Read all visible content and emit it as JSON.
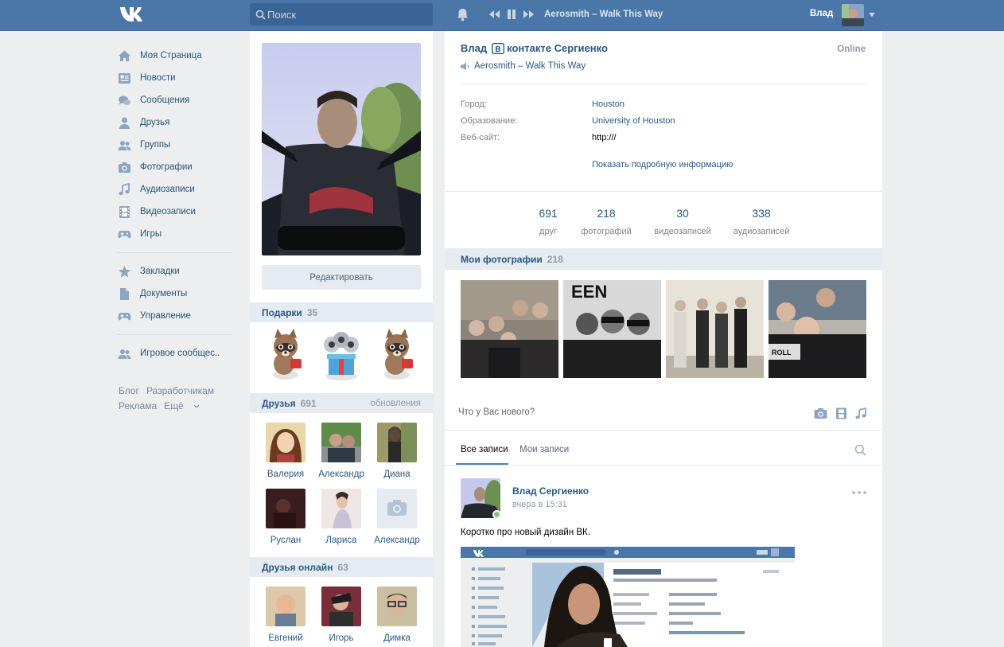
{
  "topbar": {
    "search_placeholder": "Поиск",
    "track": "Aerosmith – Walk This Way",
    "user_name": "Влад"
  },
  "nav": {
    "items": [
      {
        "label": "Моя Страница",
        "icon": "house-icon"
      },
      {
        "label": "Новости",
        "icon": "news-icon"
      },
      {
        "label": "Сообщения",
        "icon": "chat-bubbles-icon"
      },
      {
        "label": "Друзья",
        "icon": "person-icon"
      },
      {
        "label": "Группы",
        "icon": "people-icon"
      },
      {
        "label": "Фотографии",
        "icon": "camera-icon"
      },
      {
        "label": "Аудиозаписи",
        "icon": "music-note-icon"
      },
      {
        "label": "Видеозаписи",
        "icon": "film-icon"
      },
      {
        "label": "Игры",
        "icon": "gamepad-icon"
      }
    ],
    "items2": [
      {
        "label": "Закладки",
        "icon": "star-icon"
      },
      {
        "label": "Документы",
        "icon": "document-icon"
      },
      {
        "label": "Управление",
        "icon": "gamepad-icon"
      }
    ],
    "items3": [
      {
        "label": "Игровое сообщес..",
        "icon": "people-icon"
      }
    ],
    "footer": {
      "blog": "Блог",
      "dev": "Разработчикам",
      "ads": "Реклама",
      "more": "Ещё"
    }
  },
  "narrow": {
    "edit_label": "Редактировать",
    "gifts": {
      "title": "Подарки",
      "count": "35"
    },
    "friends": {
      "title": "Друзья",
      "count": "691",
      "updates": "обновления",
      "list": [
        "Валерия",
        "Александр",
        "Диана",
        "Руслан",
        "Лариса",
        "Александр"
      ]
    },
    "friends_online": {
      "title": "Друзья онлайн",
      "count": "63",
      "list": [
        "Евгений",
        "Игорь",
        "Димка"
      ]
    }
  },
  "profile": {
    "first_name": "Влад",
    "last_name": "контакте Сергиенко",
    "online": "Online",
    "status": "Aerosmith – Walk This Way",
    "info": [
      {
        "label": "Город:",
        "value": "Houston"
      },
      {
        "label": "Образование:",
        "value": "University of Houston"
      },
      {
        "label": "Веб-сайт:",
        "value": "http:///"
      }
    ],
    "more_info": "Показать подробную информацию",
    "counters": [
      {
        "n": "691",
        "l": "друг"
      },
      {
        "n": "218",
        "l": "фотографий"
      },
      {
        "n": "30",
        "l": "видеозаписей"
      },
      {
        "n": "338",
        "l": "аудиозаписей"
      }
    ],
    "photos": {
      "title": "Мои фотографии",
      "count": "218"
    }
  },
  "wall": {
    "composer_placeholder": "Что у Вас нового?",
    "tabs": [
      "Все записи",
      "Мои записи"
    ],
    "post": {
      "author": "Влад Сергиенко",
      "time": "вчера в 15:31",
      "text": "Коротко про новый дизайн ВК."
    }
  }
}
